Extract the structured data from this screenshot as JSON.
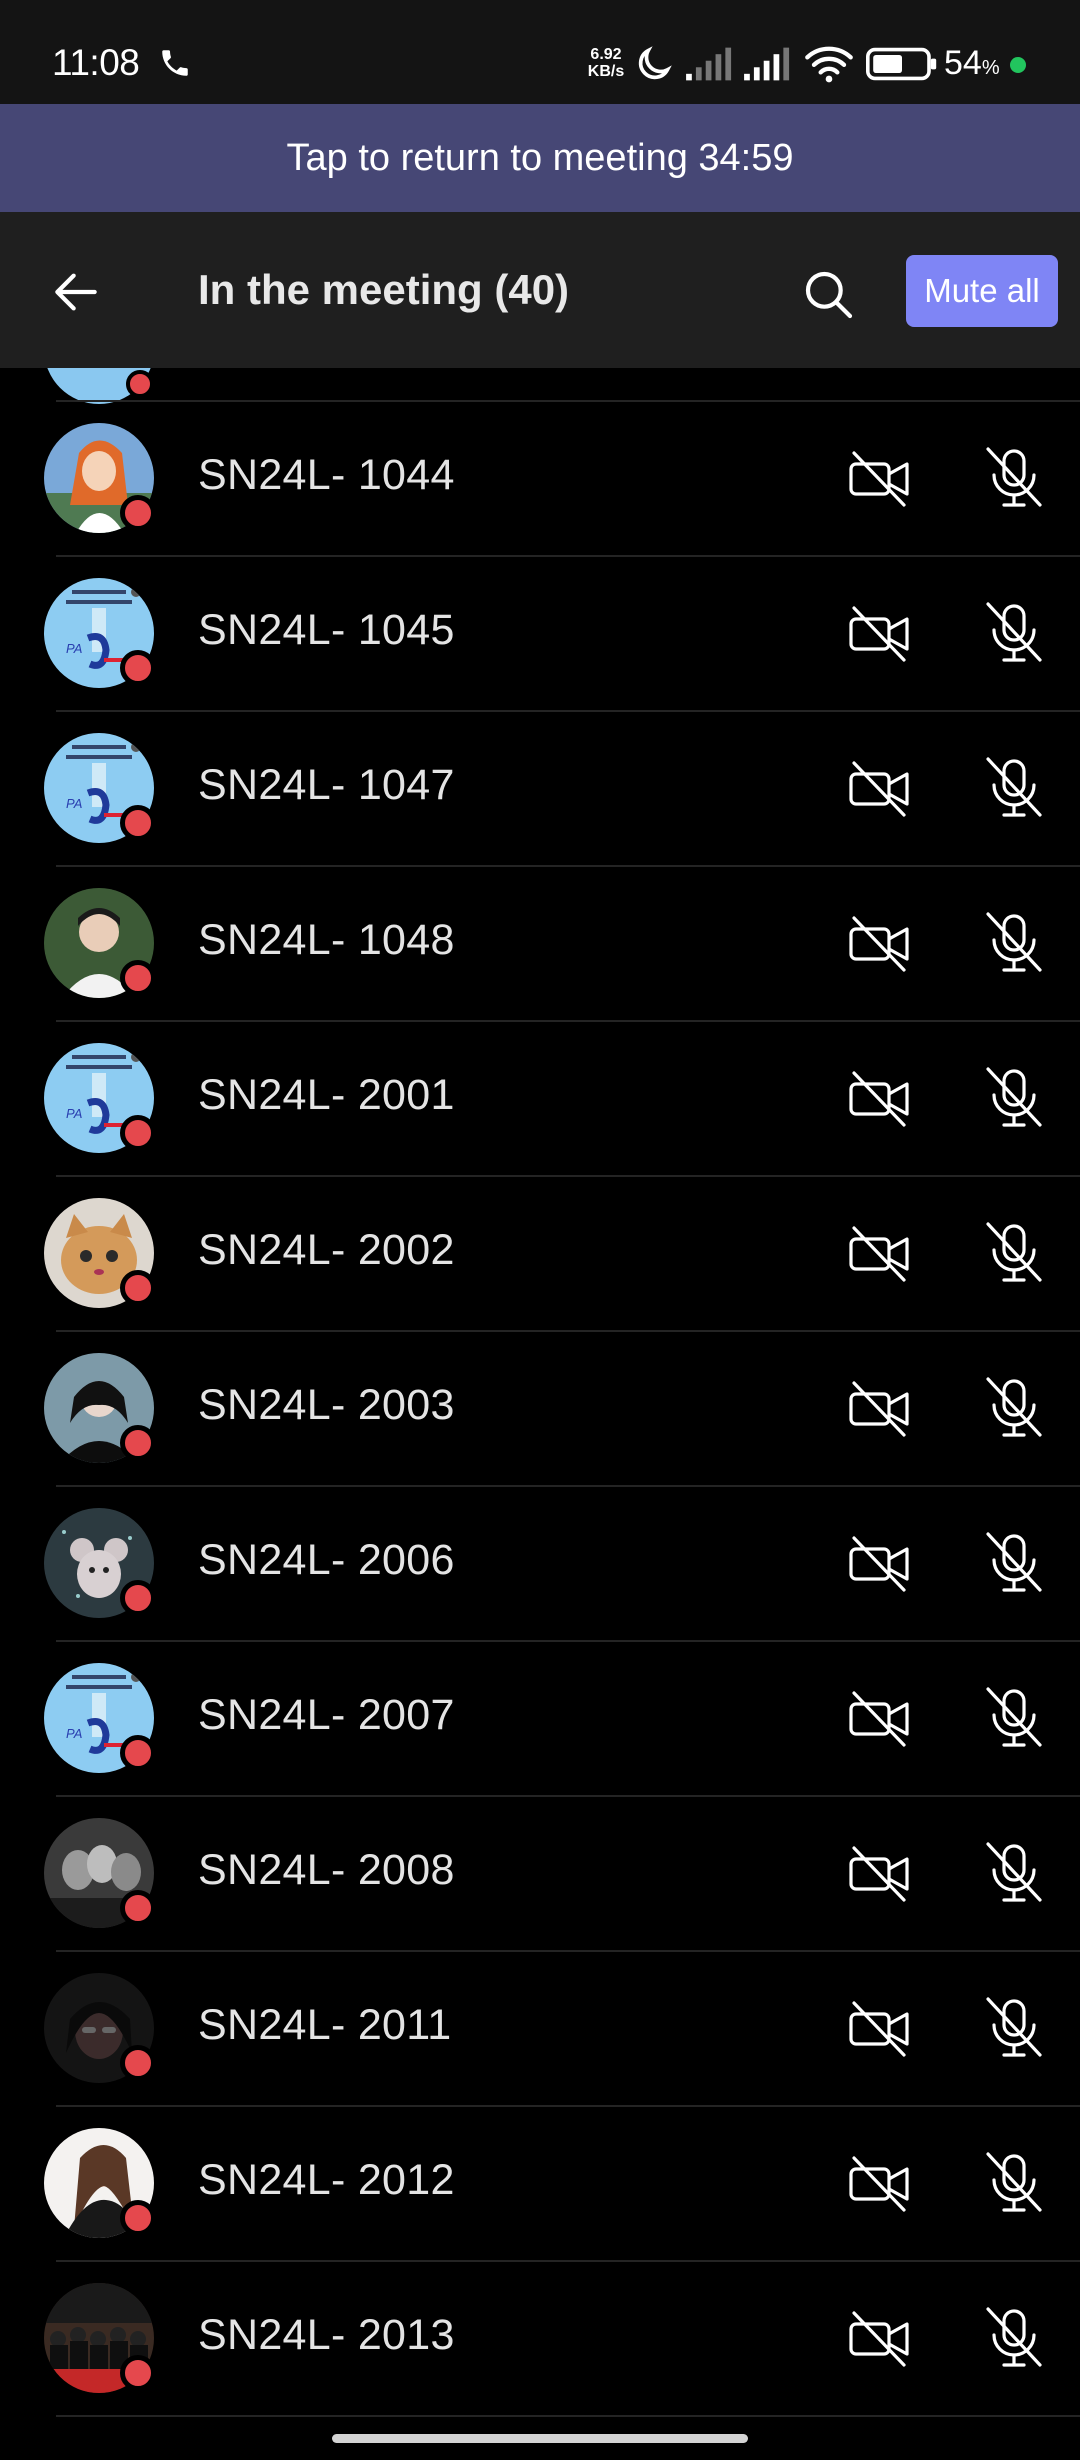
{
  "status_bar": {
    "time": "11:08",
    "net_speed_value": "6.92",
    "net_speed_unit": "KB/s",
    "battery_percent": "54",
    "battery_symbol": "%",
    "icons": [
      "phone-icon",
      "moon-icon",
      "signal-icon",
      "signal-icon",
      "wifi-icon",
      "battery-icon"
    ]
  },
  "banner": {
    "text": "Tap to return to meeting 34:59"
  },
  "header": {
    "title": "In the meeting (40)",
    "mute_all_label": "Mute all"
  },
  "colors": {
    "banner_bg": "#464775",
    "header_bg": "#1f1f1f",
    "accent": "#7f85f5",
    "presence_busy": "#e5484d"
  },
  "participants": [
    {
      "name": "SN24L- 1044",
      "avatar": "anime-girl"
    },
    {
      "name": "SN24L- 1045",
      "avatar": "school-logo"
    },
    {
      "name": "SN24L- 1047",
      "avatar": "school-logo"
    },
    {
      "name": "SN24L- 1048",
      "avatar": "photo-person"
    },
    {
      "name": "SN24L- 2001",
      "avatar": "school-logo"
    },
    {
      "name": "SN24L- 2002",
      "avatar": "kitten"
    },
    {
      "name": "SN24L- 2003",
      "avatar": "photo-person-dark"
    },
    {
      "name": "SN24L- 2006",
      "avatar": "mouse-toy"
    },
    {
      "name": "SN24L- 2007",
      "avatar": "school-logo"
    },
    {
      "name": "SN24L- 2008",
      "avatar": "photo-group-bw"
    },
    {
      "name": "SN24L- 2011",
      "avatar": "photo-dark-person"
    },
    {
      "name": "SN24L- 2012",
      "avatar": "photo-woman"
    },
    {
      "name": "SN24L- 2013",
      "avatar": "photo-crowd"
    }
  ]
}
